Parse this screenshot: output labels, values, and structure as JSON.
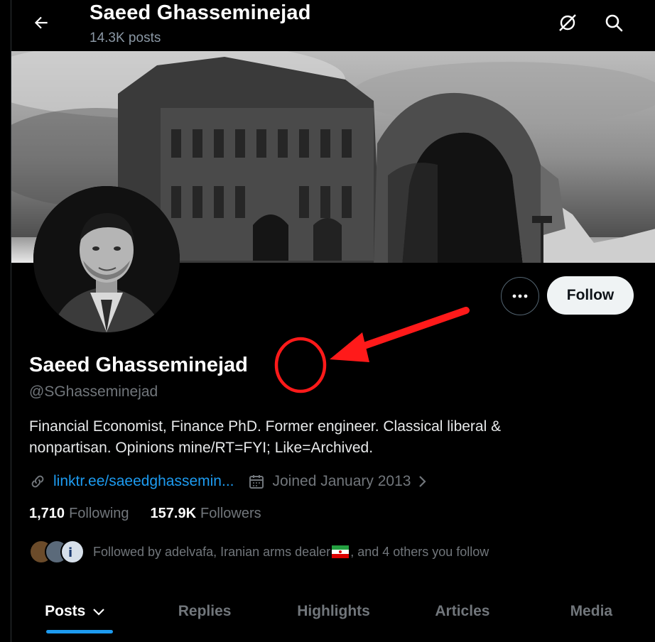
{
  "header": {
    "title": "Saeed Ghasseminejad",
    "posts_count": "14.3K posts"
  },
  "profile": {
    "name": "Saeed Ghasseminejad",
    "handle": "@SGhasseminejad",
    "bio_line1": "Financial Economist, Finance PhD. Former engineer. Classical liberal &",
    "bio_line2": "nonpartisan. Opinions mine/RT=FYI; Like=Archived.",
    "link": "linktr.ee/saeedghassemin...",
    "joined": "Joined January 2013"
  },
  "actions": {
    "follow_label": "Follow"
  },
  "stats": {
    "following_count": "1,710",
    "following_label": "Following",
    "followers_count": "157.9K",
    "followers_label": "Followers"
  },
  "followed_by": {
    "text_before": "Followed by adelvafa, Iranian arms dealer ",
    "text_after": ", and 4 others you follow"
  },
  "tabs": [
    {
      "label": "Posts"
    },
    {
      "label": "Replies"
    },
    {
      "label": "Highlights"
    },
    {
      "label": "Articles"
    },
    {
      "label": "Media"
    }
  ],
  "colors": {
    "accent": "#1d9bf0",
    "annotation": "#ff1a1a",
    "background": "#000000"
  },
  "icons": [
    "back-arrow-icon",
    "grok-icon",
    "search-icon",
    "more-icon",
    "link-icon",
    "calendar-icon",
    "chevron-right-icon",
    "chevron-down-icon",
    "iran-flag-icon"
  ]
}
